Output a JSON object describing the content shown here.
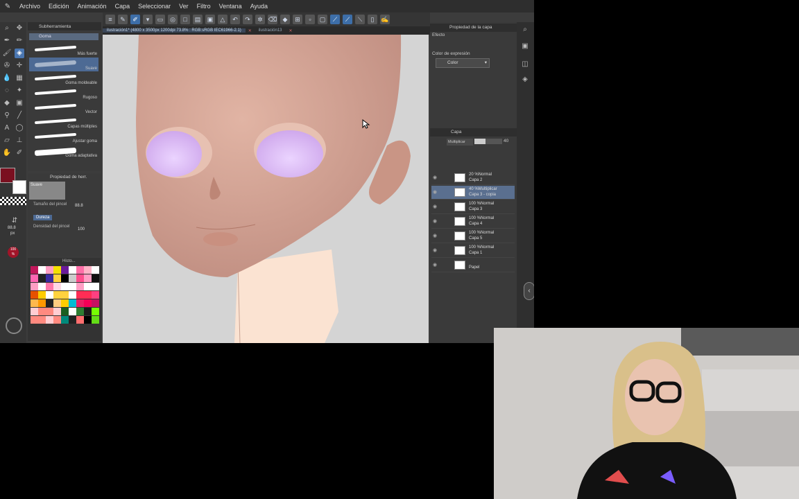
{
  "menu": [
    "Archivo",
    "Edición",
    "Animación",
    "Capa",
    "Seleccionar",
    "Ver",
    "Filtro",
    "Ventana",
    "Ayuda"
  ],
  "tabs": {
    "active": "ilustración1* (4800 x 3500px 1200dpi 73.8% : RGB:sRGB IEC61966-2.1)",
    "other": "ilustración13"
  },
  "subtool": {
    "header": "Subherramienta",
    "group": "Goma",
    "brushes": [
      "Más fuerte",
      "Suave",
      "Goma moldeable",
      "Rugoso",
      "Vector",
      "Capas múltiples",
      "Ajustar goma",
      "Goma adaptativa"
    ],
    "selected": "Suave"
  },
  "tool_property": {
    "header": "Propiedad de herr.",
    "current": "Suave",
    "brush_size_label": "Tamaño del pincel",
    "brush_size": "88.8",
    "hardness_label": "Dureza",
    "density_label": "Densidad del pincel",
    "density": "100",
    "side_size": "88.8",
    "side_unit": "px",
    "side_percent": "100",
    "side_percent_unit": "%"
  },
  "palette_header": "Histo...",
  "palette_colors": [
    "#c2185b",
    "#ffffff",
    "#ff9ec4",
    "#f4e000",
    "#6a1b9a",
    "#ffffff",
    "#ff6fa8",
    "#ffb3c7",
    "#ffffff",
    "#ff66b2",
    "#222222",
    "#3a2aa0",
    "#ffd23f",
    "#000000",
    "#cccccc",
    "#ff4d8d",
    "#ff9ec4",
    "#111111",
    "#ff9ec4",
    "#ffffff",
    "#ff77aa",
    "#ffd7e5",
    "#ffffff",
    "#ffffff",
    "#ff9ec4",
    "#ffffff",
    "#ffffff",
    "#e65100",
    "#ffcc00",
    "#ffffff",
    "#ffd23f",
    "#ffd23f",
    "#ffffff",
    "#ff2d55",
    "#ff2d55",
    "#ff4081",
    "#ffb84d",
    "#ff9800",
    "#222222",
    "#ffcc80",
    "#ffcc00",
    "#00bcd4",
    "#e91e63",
    "#f50057",
    "#c51162",
    "#ffcdd2",
    "#ff8a80",
    "#ff8a80",
    "#ffcdd2",
    "#1b5e20",
    "#ffffff",
    "#2e7d32",
    "#1b1b1b",
    "#76ff03",
    "#ff8a80",
    "#ff8a80",
    "#ffcdd2",
    "#ff8a80",
    "#00897b",
    "#222222",
    "#ff6e6e",
    "#000000",
    "#64dd17"
  ],
  "right_panel": {
    "header": "Propiedad de la capa",
    "effect_label": "Efecto",
    "expression_label": "Color de expresión",
    "expression_value": "Color",
    "layer_header": "Capa",
    "blend_mode": "Multiplicar",
    "opacity": "40",
    "layers": [
      {
        "line1": "20 %Normal",
        "line2": "Capa 2",
        "selected": false
      },
      {
        "line1": "40 %Multiplicar",
        "line2": "Capa 3 - copia",
        "selected": true
      },
      {
        "line1": "100 %Normal",
        "line2": "Capa 3",
        "selected": false
      },
      {
        "line1": "100 %Normal",
        "line2": "Capa 4",
        "selected": false
      },
      {
        "line1": "100 %Normal",
        "line2": "Capa 5",
        "selected": false
      },
      {
        "line1": "100 %Normal",
        "line2": "Capa 1",
        "selected": false
      },
      {
        "line1": "",
        "line2": "Papel",
        "selected": false
      }
    ]
  },
  "colors": {
    "main_color": "#7a1020",
    "sub_color": "#ffffff",
    "skin": "#d09a8a",
    "eye": "#dcbbf2",
    "neck": "#fbe2d2"
  }
}
